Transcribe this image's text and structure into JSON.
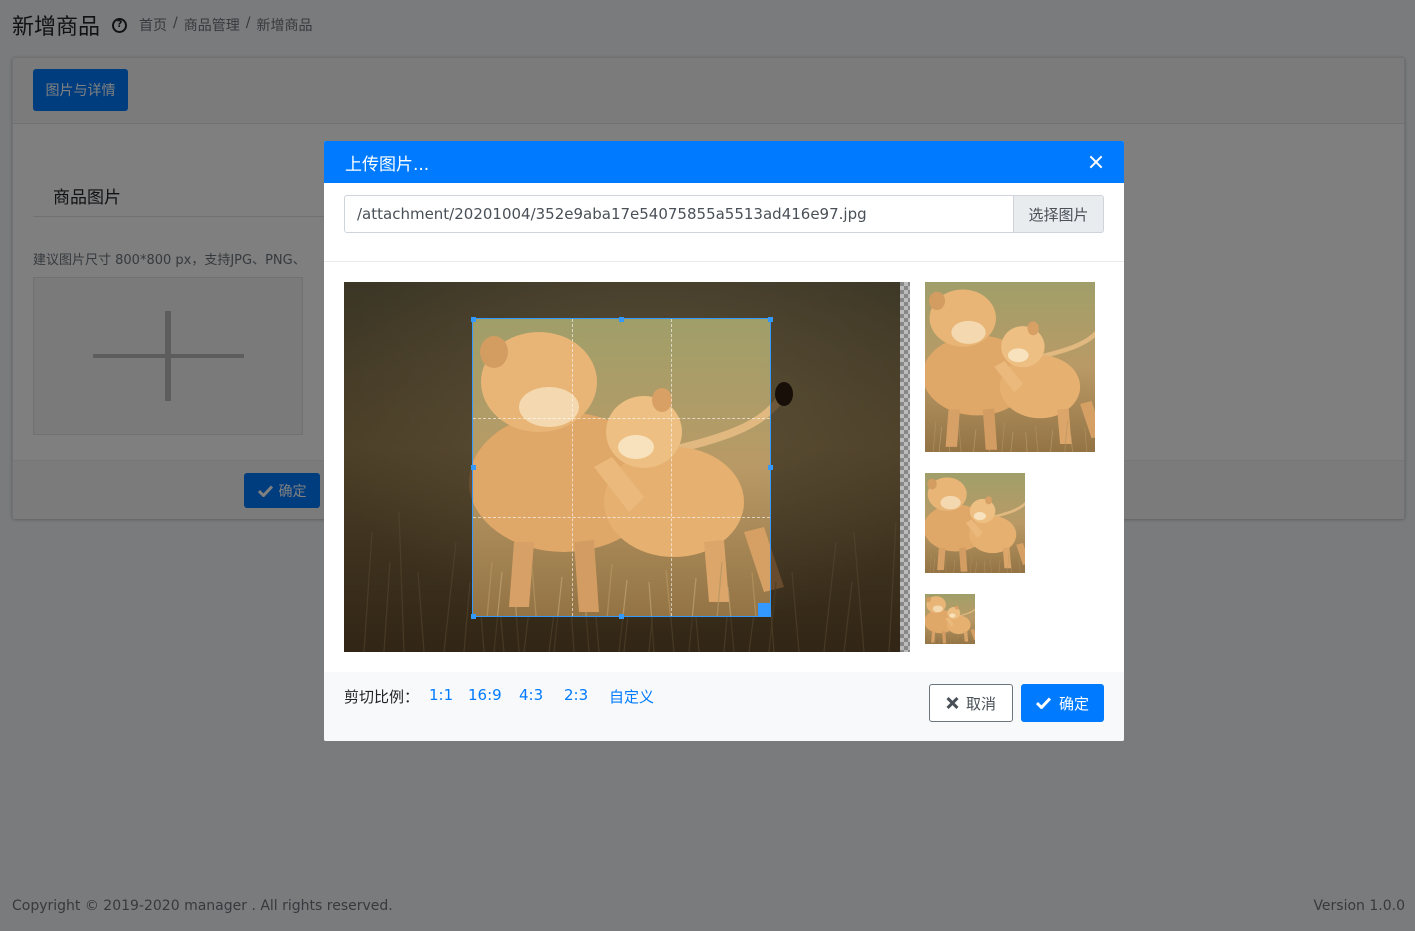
{
  "page": {
    "title": "新增商品",
    "breadcrumb": [
      "首页",
      "商品管理",
      "新增商品"
    ],
    "breadcrumb_sep": "/",
    "tab_label": "图片与详情",
    "section_title": "商品图片",
    "hint": "建议图片尺寸 800*800 px，支持JPG、PNG、",
    "confirm_label": "确定"
  },
  "footer": {
    "copyright": "Copyright © 2019-2020 manager . All rights reserved.",
    "version": "Version 1.0.0"
  },
  "modal": {
    "title": "上传图片...",
    "file_path": "/attachment/20201004/352e9aba17e54075855a5513ad416e97.jpg",
    "choose_button": "选择图片",
    "ratio_label": "剪切比例：",
    "ratios": [
      "1:1",
      "16:9",
      "4:3",
      "2:3",
      "自定义"
    ],
    "cancel_label": "取消",
    "ok_label": "确定"
  },
  "colors": {
    "primary": "#007bff",
    "crop_accent": "#3399ff",
    "overlay": "rgba(0,0,0,0.5)"
  },
  "icons": [
    "help-icon",
    "close-icon",
    "plus-icon",
    "check-icon",
    "times-icon"
  ]
}
